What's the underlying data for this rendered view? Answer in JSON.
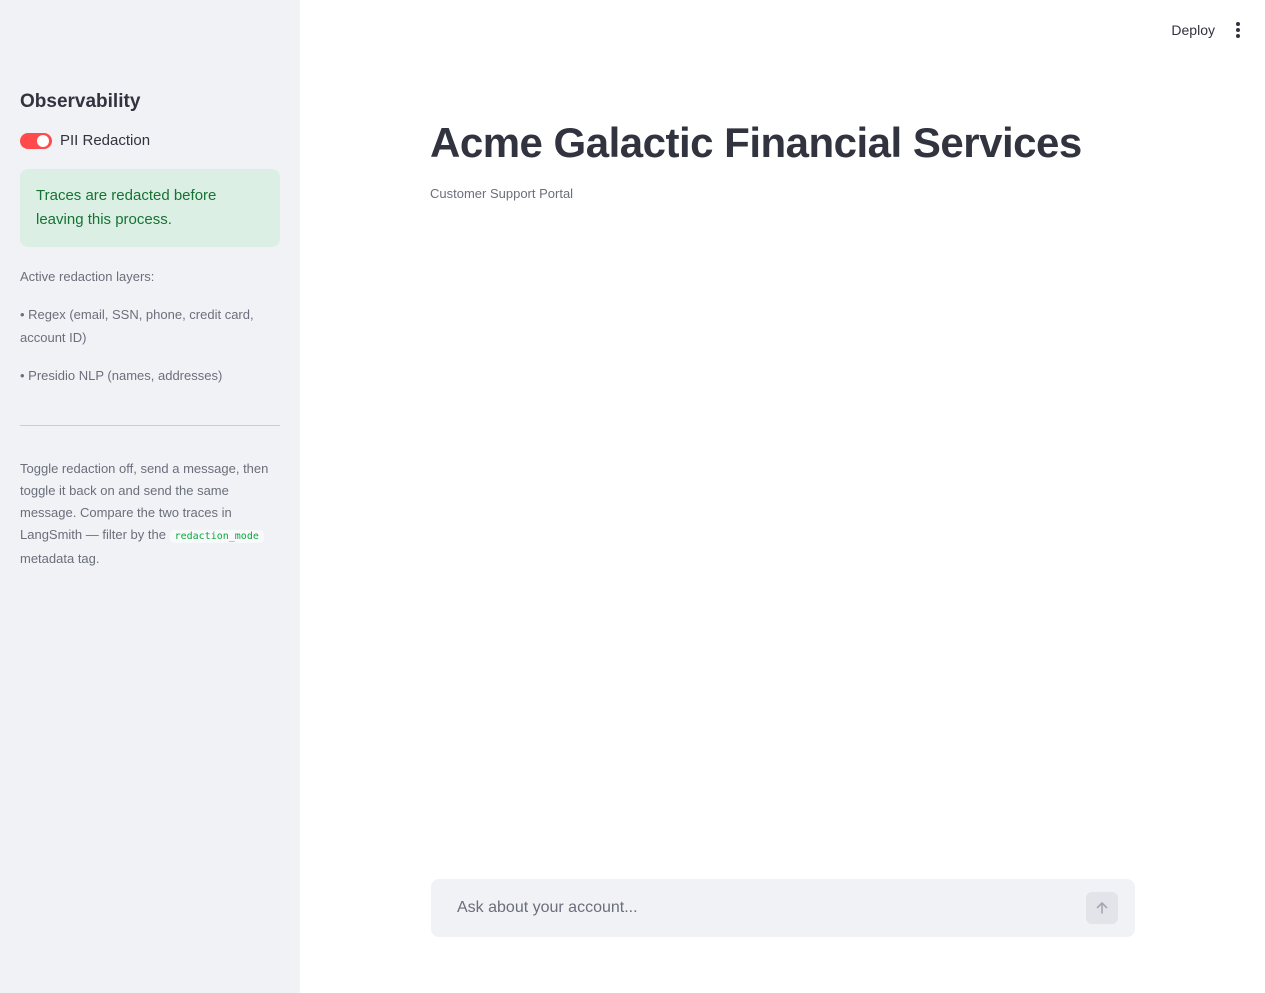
{
  "sidebar": {
    "title": "Observability",
    "toggle": {
      "label": "PII Redaction",
      "state": "on",
      "color": "#ff4b4b"
    },
    "success_message": "Traces are redacted before leaving this process.",
    "layers_heading": "Active redaction layers:",
    "layers": [
      "• Regex (email, SSN, phone, credit card, account ID)",
      "• Presidio NLP (names, addresses)"
    ],
    "help": {
      "text_before": "Toggle redaction off, send a message, then toggle it back on and send the same message. Compare the two traces in LangSmith — filter by the ",
      "code": "redaction_mode",
      "text_after": " metadata tag."
    }
  },
  "header": {
    "deploy_label": "Deploy",
    "menu_icon": "kebab-menu-icon"
  },
  "main": {
    "title": "Acme Galactic Financial Services",
    "subtitle": "Customer Support Portal"
  },
  "chat": {
    "placeholder": "Ask about your account...",
    "value": "",
    "send_icon": "arrow-up-icon"
  },
  "colors": {
    "accent": "#ff4b4b",
    "success_bg": "#dbefe5",
    "success_text": "#177233",
    "sidebar_bg": "#f0f2f6"
  }
}
